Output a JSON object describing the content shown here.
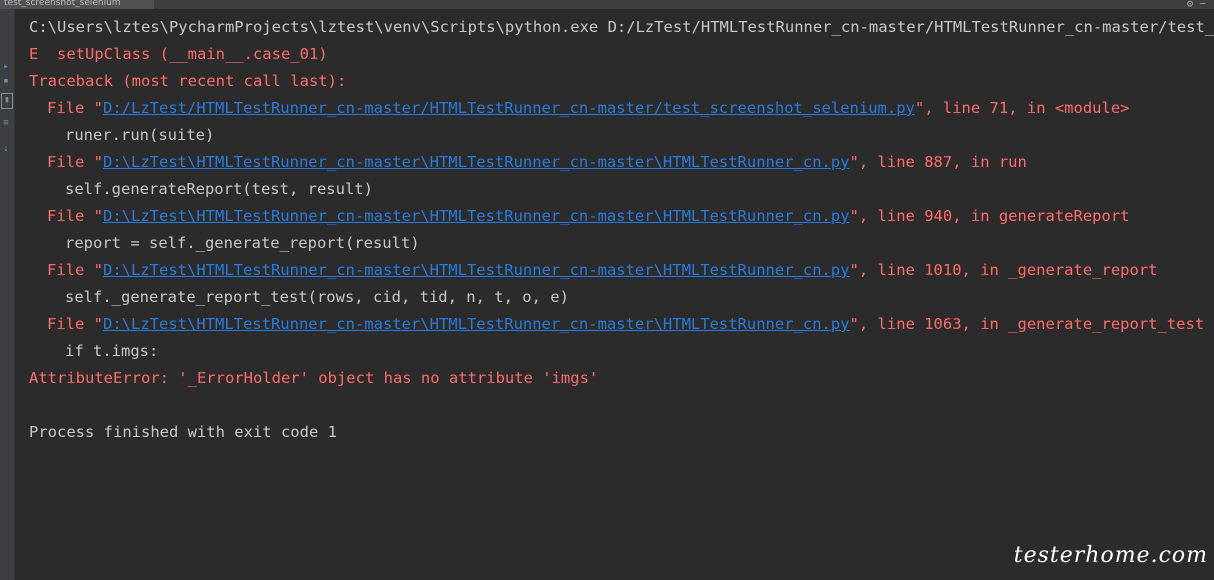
{
  "tab": {
    "label": "test_screenshot_selenium"
  },
  "console": {
    "command": "C:\\Users\\lztes\\PycharmProjects\\lztest\\venv\\Scripts\\python.exe D:/LzTest/HTMLTestRunner_cn-master/HTMLTestRunner_cn-master/test_scree",
    "error_line": "E  setUpClass (__main__.case_01)",
    "traceback_header": "Traceback (most recent call last):",
    "frames": [
      {
        "prefix": "File \"",
        "path": "D:/LzTest/HTMLTestRunner_cn-master/HTMLTestRunner_cn-master/test_screenshot_selenium.py",
        "suffix": "\", line 71, in <module>",
        "code": "runer.run(suite)"
      },
      {
        "prefix": "File \"",
        "path": "D:\\LzTest\\HTMLTestRunner_cn-master\\HTMLTestRunner_cn-master\\HTMLTestRunner_cn.py",
        "suffix": "\", line 887, in run",
        "code": "self.generateReport(test, result)"
      },
      {
        "prefix": "File \"",
        "path": "D:\\LzTest\\HTMLTestRunner_cn-master\\HTMLTestRunner_cn-master\\HTMLTestRunner_cn.py",
        "suffix": "\", line 940, in generateReport",
        "code": "report = self._generate_report(result)"
      },
      {
        "prefix": "File \"",
        "path": "D:\\LzTest\\HTMLTestRunner_cn-master\\HTMLTestRunner_cn-master\\HTMLTestRunner_cn.py",
        "suffix": "\", line 1010, in _generate_report",
        "code": "self._generate_report_test(rows, cid, tid, n, t, o, e)"
      },
      {
        "prefix": "File \"",
        "path": "D:\\LzTest\\HTMLTestRunner_cn-master\\HTMLTestRunner_cn-master\\HTMLTestRunner_cn.py",
        "suffix": "\", line 1063, in _generate_report_test",
        "code": "if t.imgs:"
      }
    ],
    "exception": "AttributeError: '_ErrorHolder' object has no attribute 'imgs'",
    "exit_message": "Process finished with exit code 1"
  },
  "watermark": "testerhome.com",
  "colors": {
    "background": "#2b2b2b",
    "normal_text": "#c8c8c8",
    "error_text": "#ff6b68",
    "link": "#287bde"
  },
  "icons": [
    "gear-icon",
    "minimize-icon",
    "rerun-icon",
    "stop-icon",
    "pin-icon",
    "settings-icon"
  ]
}
